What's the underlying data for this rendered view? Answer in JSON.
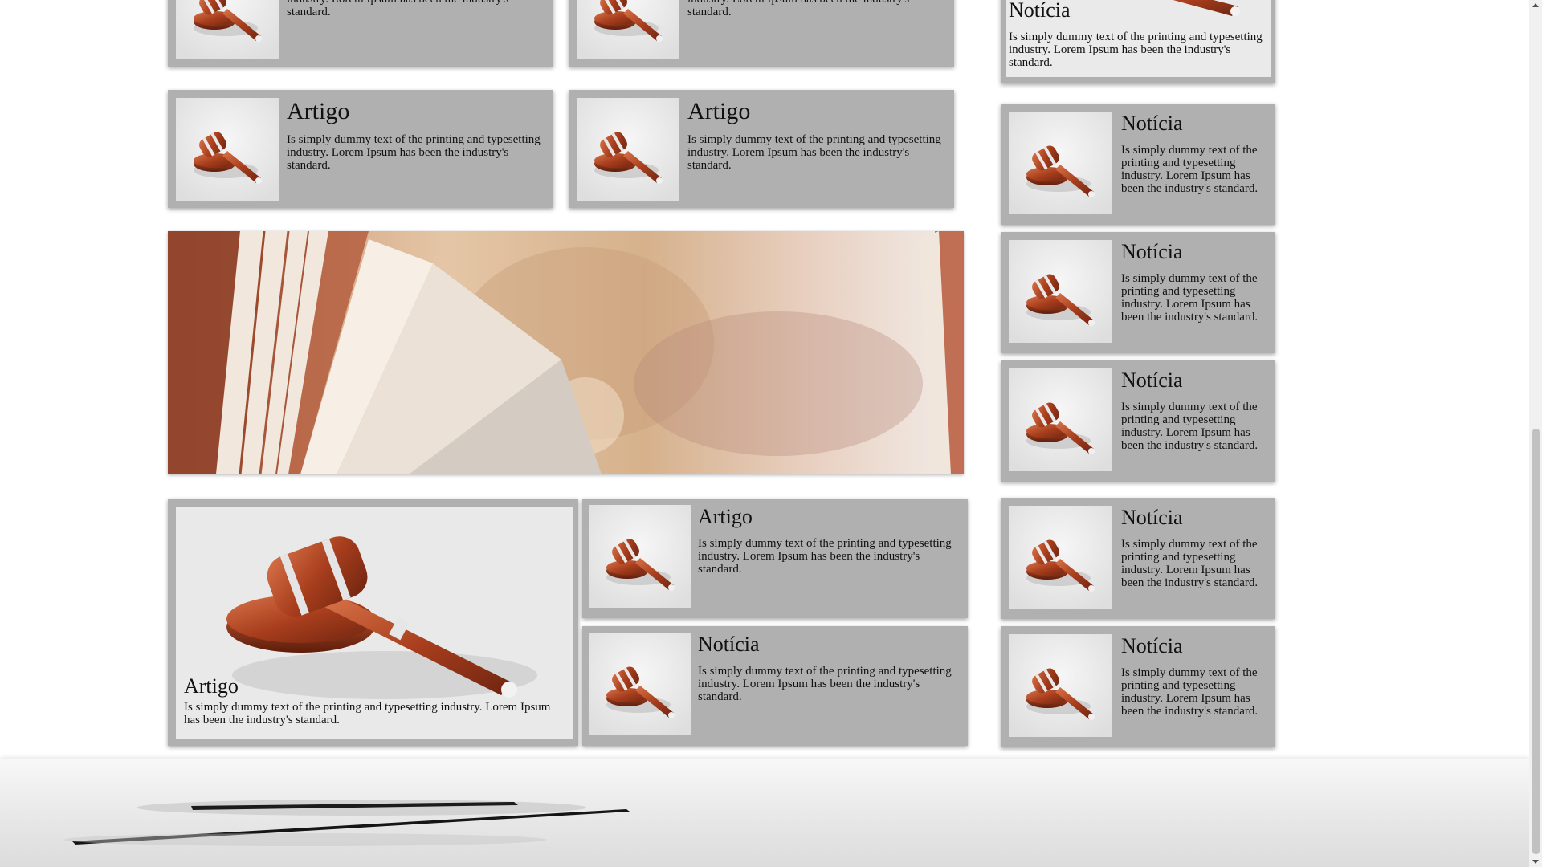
{
  "colors": {
    "card_bg": "#b0b0b0",
    "page_bg": "#ffffff",
    "featured_bg": "#e6e6e6"
  },
  "body_text": "Is simply dummy text of the printing and typesetting industry. Lorem Ipsum has been the industry's standard.",
  "articles_top_row": [
    {
      "title": "",
      "text": "Is simply dummy text of the printing and typesetting industry. Lorem Ipsum has been the industry's standard."
    },
    {
      "title": "",
      "text": "Is simply dummy text of the printing and typesetting industry. Lorem Ipsum has been the industry's standard."
    }
  ],
  "articles_row2": [
    {
      "title": "Artigo",
      "text": "Is simply dummy text of the printing and typesetting industry. Lorem Ipsum has been the industry's standard."
    },
    {
      "title": "Artigo",
      "text": "Is simply dummy text of the printing and typesetting industry. Lorem Ipsum has been the industry's standard."
    }
  ],
  "featured": {
    "title": "Artigo",
    "text": "Is simply dummy text of the printing and typesetting industry. Lorem Ipsum has been the industry's standard."
  },
  "stack": [
    {
      "title": "Artigo",
      "text": "Is simply dummy text of the printing and typesetting industry. Lorem Ipsum has been the industry's standard."
    },
    {
      "title": "Notícia",
      "text": "Is simply dummy text of the printing and typesetting industry. Lorem Ipsum has been the industry's standard."
    }
  ],
  "sidebar": {
    "top": {
      "title": "Notícia",
      "text": "Is simply dummy text of the printing and typesetting industry. Lorem Ipsum has been the industry's standard."
    },
    "items": [
      {
        "title": "Notícia",
        "text": "Is simply dummy text of the printing and typesetting industry. Lorem Ipsum has been the industry's standard."
      },
      {
        "title": "Notícia",
        "text": "Is simply dummy text of the printing and typesetting industry. Lorem Ipsum has been the industry's standard."
      },
      {
        "title": "Notícia",
        "text": "Is simply dummy text of the printing and typesetting industry. Lorem Ipsum has been the industry's standard."
      },
      {
        "title": "Notícia",
        "text": "Is simply dummy text of the printing and typesetting industry. Lorem Ipsum has been the industry's standard."
      },
      {
        "title": "Notícia",
        "text": "Is simply dummy text of the printing and typesetting industry. Lorem Ipsum has been the industry's standard."
      }
    ]
  }
}
